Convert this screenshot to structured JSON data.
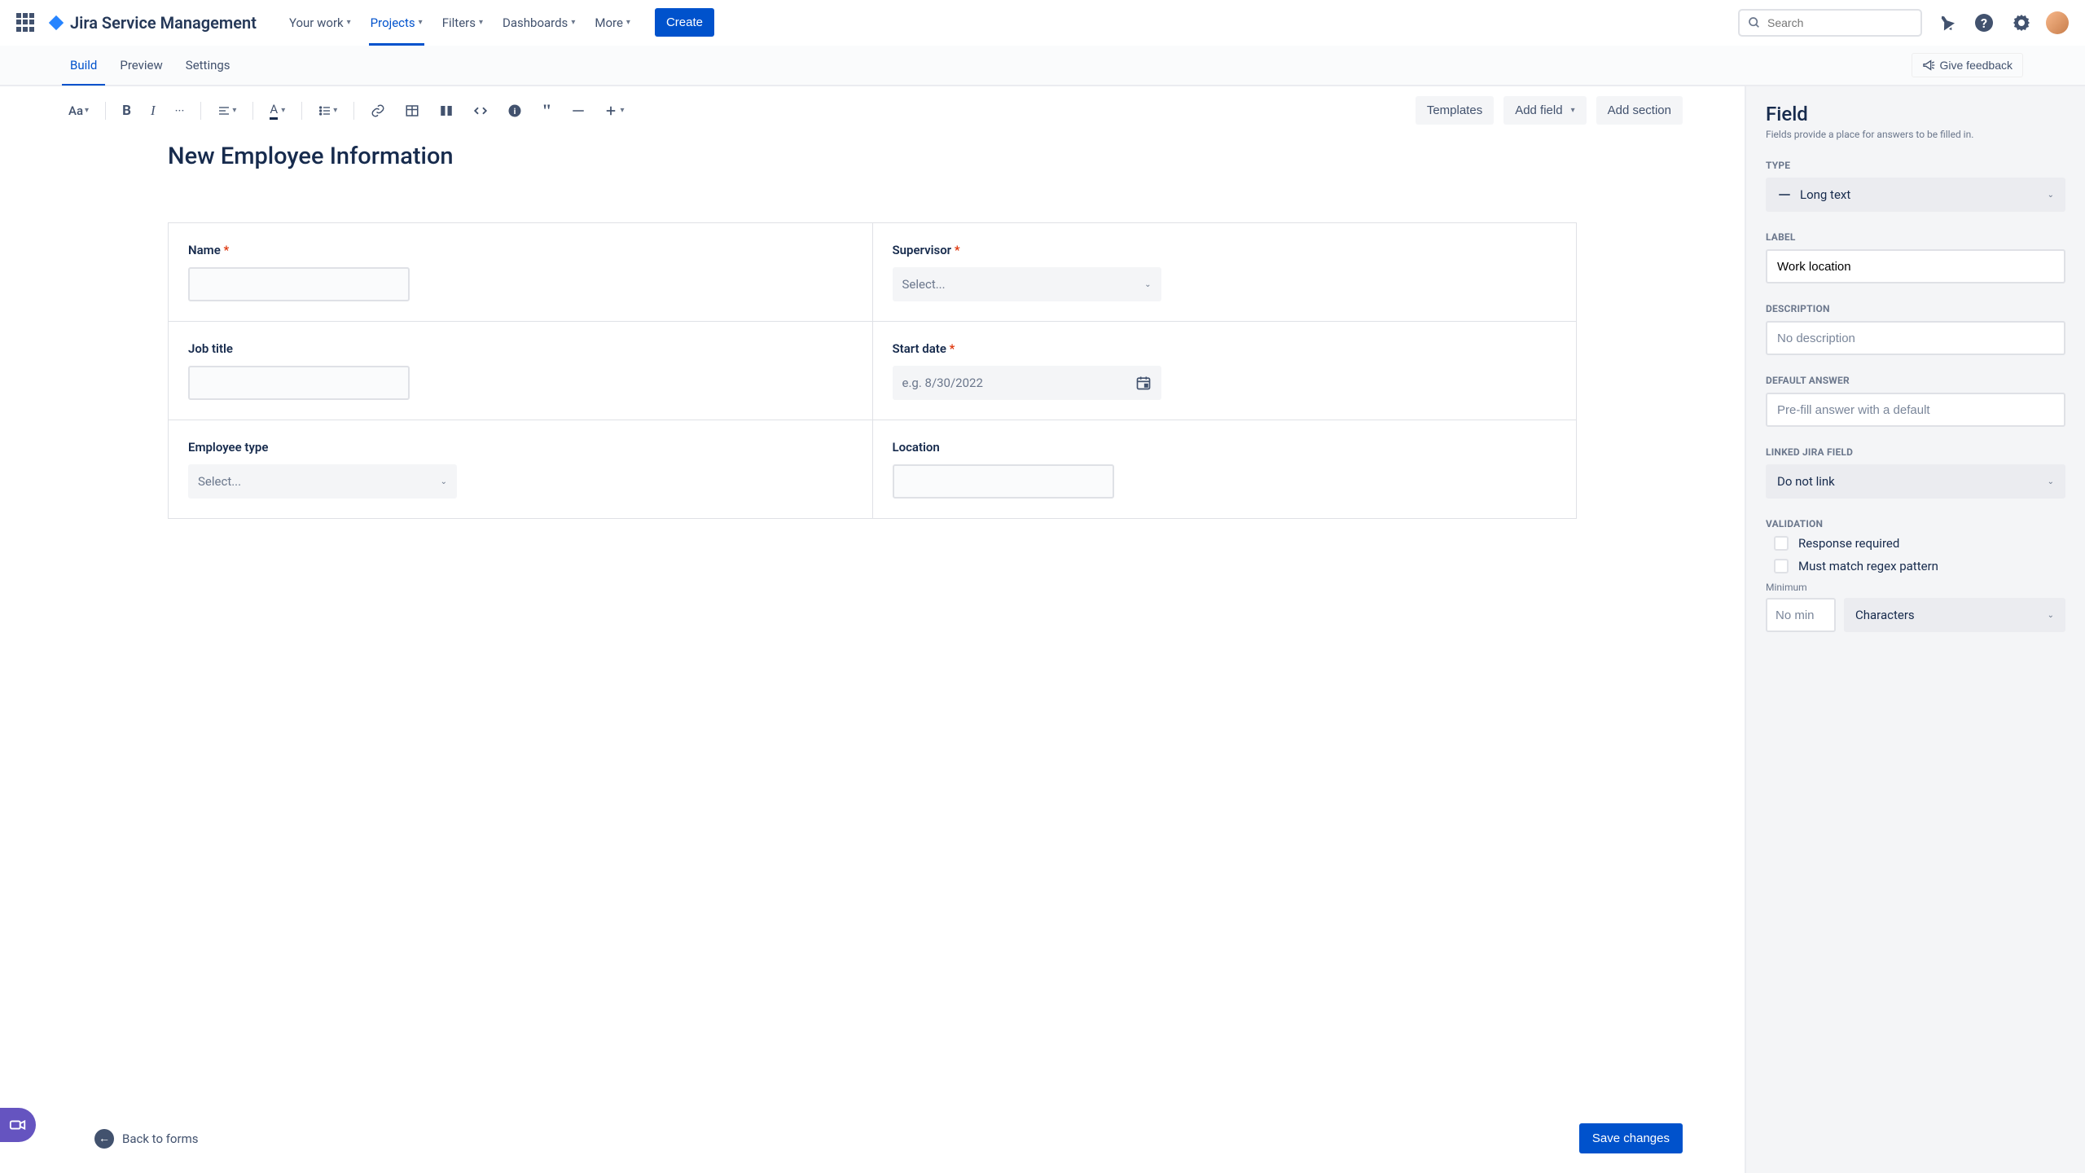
{
  "topnav": {
    "product_name": "Jira Service Management",
    "items": [
      "Your work",
      "Projects",
      "Filters",
      "Dashboards",
      "More"
    ],
    "active_index": 1,
    "create": "Create",
    "search_placeholder": "Search"
  },
  "tabs": {
    "items": [
      "Build",
      "Preview",
      "Settings"
    ],
    "active_index": 0,
    "feedback": "Give feedback"
  },
  "toolbar": {
    "text_style": "Aa",
    "templates": "Templates",
    "add_field": "Add field",
    "add_section": "Add section"
  },
  "doc": {
    "title": "New Employee Information",
    "fields": {
      "name": {
        "label": "Name",
        "required": true
      },
      "supervisor": {
        "label": "Supervisor",
        "required": true,
        "placeholder": "Select..."
      },
      "job_title": {
        "label": "Job title",
        "required": false
      },
      "start_date": {
        "label": "Start date",
        "required": true,
        "placeholder": "e.g. 8/30/2022"
      },
      "employee_type": {
        "label": "Employee type",
        "required": false,
        "placeholder": "Select..."
      },
      "location": {
        "label": "Location",
        "required": false
      }
    }
  },
  "footer": {
    "back": "Back to forms",
    "save": "Save changes"
  },
  "side": {
    "title": "Field",
    "subtitle": "Fields provide a place for answers to be filled in.",
    "type_label": "TYPE",
    "type_value": "Long text",
    "label_label": "LABEL",
    "label_value": "Work location",
    "desc_label": "DESCRIPTION",
    "desc_placeholder": "No description",
    "default_label": "DEFAULT ANSWER",
    "default_placeholder": "Pre-fill answer with a default",
    "linked_label": "LINKED JIRA FIELD",
    "linked_value": "Do not link",
    "validation_label": "VALIDATION",
    "cb_required": "Response required",
    "cb_regex": "Must match regex pattern",
    "min_label": "Minimum",
    "min_placeholder": "No min",
    "min_unit": "Characters"
  }
}
